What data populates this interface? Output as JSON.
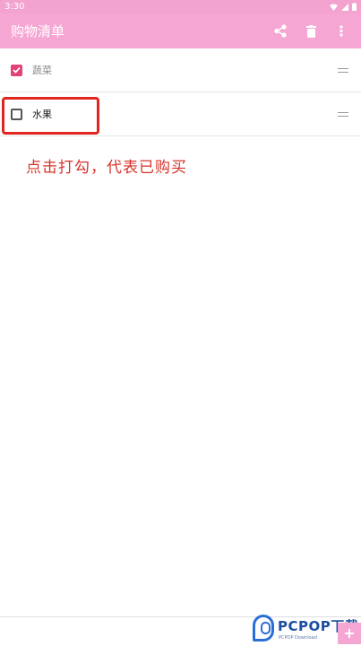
{
  "status_bar": {
    "time": "3:30",
    "icons": [
      "wifi-icon",
      "signal-icon",
      "battery-icon"
    ]
  },
  "app_bar": {
    "title": "购物清单",
    "background": "#f6a6d3",
    "actions": [
      "share-icon",
      "delete-icon",
      "more-vert-icon"
    ]
  },
  "list": {
    "items": [
      {
        "label": "蔬菜",
        "checked": true
      },
      {
        "label": "水果",
        "checked": false
      }
    ]
  },
  "annotation": {
    "text": "点击打勾，代表已购买",
    "color": "#d7332a"
  },
  "watermark": {
    "brand": "PCPOP",
    "suffix": "下载",
    "sub": "PCPOP Download"
  },
  "colors": {
    "accent": "#e2417a",
    "highlight": "#e0261e"
  }
}
